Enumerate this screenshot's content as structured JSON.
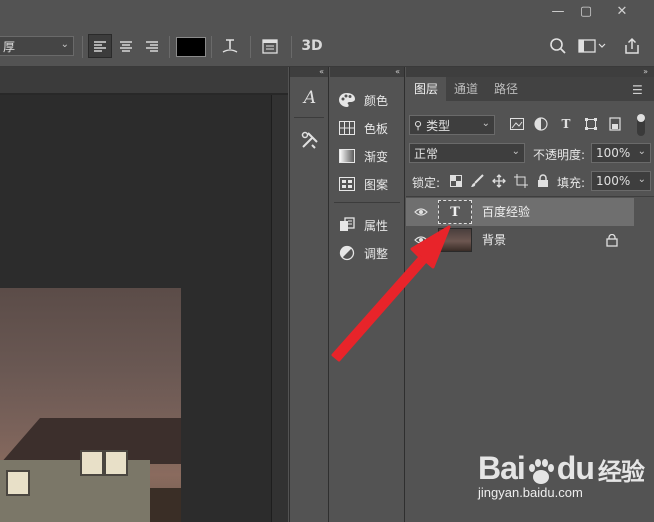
{
  "options_bar": {
    "font_style_value": "厚",
    "threed_label": "3D"
  },
  "tools_column": {
    "items": [
      {
        "icon": "character-panel-icon"
      },
      {
        "icon": "tools-preset-icon"
      }
    ]
  },
  "panels_column": {
    "items": [
      {
        "label": "颜色",
        "icon": "color-palette-icon"
      },
      {
        "label": "色板",
        "icon": "swatches-grid-icon"
      },
      {
        "label": "渐变",
        "icon": "gradient-icon"
      },
      {
        "label": "图案",
        "icon": "pattern-icon"
      },
      {
        "label": "属性",
        "icon": "properties-icon"
      },
      {
        "label": "调整",
        "icon": "adjustments-icon"
      }
    ]
  },
  "layers_panel": {
    "tabs": [
      "图层",
      "通道",
      "路径"
    ],
    "active_tab": 0,
    "filter_value": "类型",
    "blend_mode_value": "正常",
    "opacity_label": "不透明度:",
    "opacity_value": "100%",
    "lock_label": "锁定:",
    "fill_label": "填充:",
    "fill_value": "100%",
    "layers": [
      {
        "name": "百度经验",
        "type": "text",
        "thumb_glyph": "T",
        "selected": true,
        "visible": true
      },
      {
        "name": "背景",
        "type": "image",
        "selected": false,
        "visible": true,
        "locked": true
      }
    ]
  },
  "watermark": {
    "brand_a": "Bai",
    "brand_b": "du",
    "brand_cn": "经验",
    "url": "jingyan.baidu.com"
  },
  "colors": {
    "ui_bg": "#535353",
    "canvas_bg": "#282828",
    "selected_layer": "#6f6f6f",
    "arrow": "#e8242a"
  }
}
